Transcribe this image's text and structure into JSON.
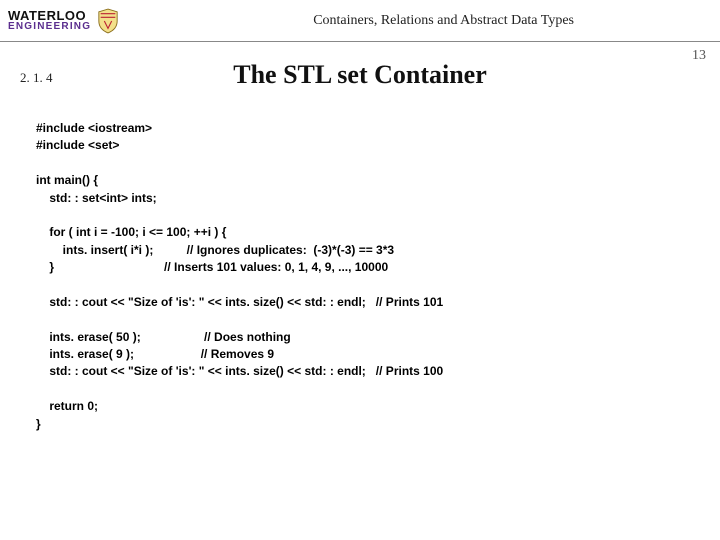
{
  "header": {
    "logo_top": "WATERLOO",
    "logo_bottom": "ENGINEERING",
    "chapter_title": "Containers, Relations and Abstract Data Types"
  },
  "page_number": "13",
  "section_number": "2. 1. 4",
  "slide_title": "The STL set Container",
  "code_text": "#include <iostream>\n#include <set>\n\nint main() {\n    std: : set<int> ints;\n\n    for ( int i = -100; i <= 100; ++i ) {\n        ints. insert( i*i );          // Ignores duplicates:  (-3)*(-3) == 3*3\n    }                                 // Inserts 101 values: 0, 1, 4, 9, ..., 10000\n\n    std: : cout << \"Size of 'is': \" << ints. size() << std: : endl;   // Prints 101\n\n    ints. erase( 50 );                   // Does nothing\n    ints. erase( 9 );                    // Removes 9\n    std: : cout << \"Size of 'is': \" << ints. size() << std: : endl;   // Prints 100\n\n    return 0;\n}"
}
